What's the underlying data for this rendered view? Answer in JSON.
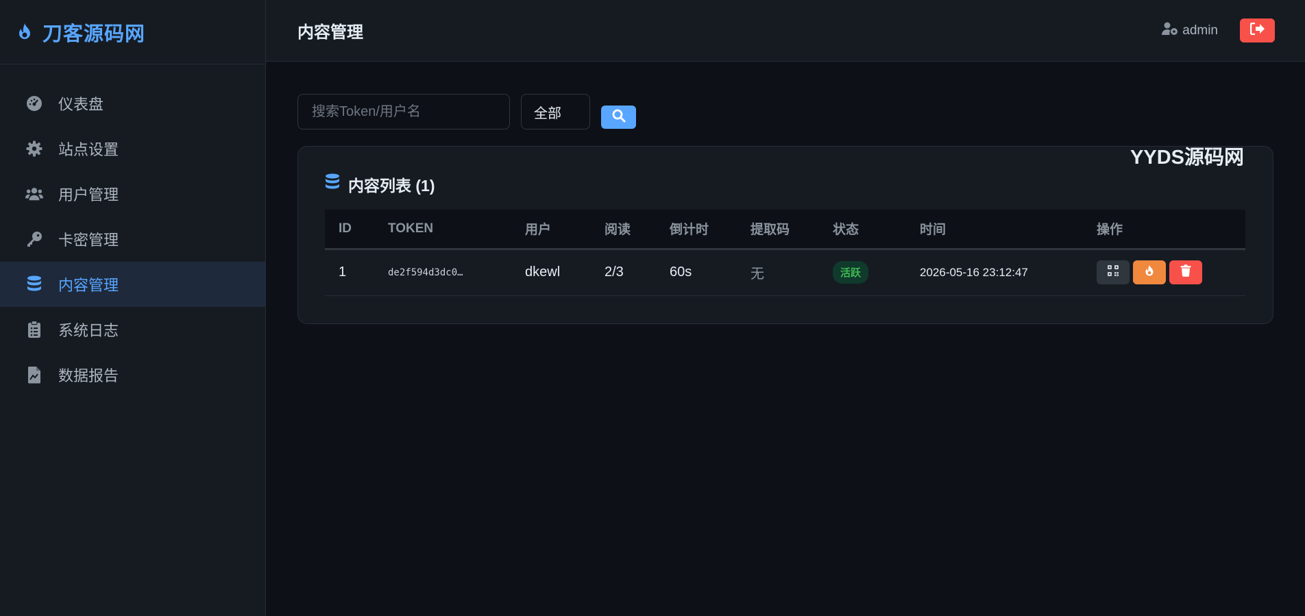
{
  "brand": {
    "name": "刀客源码网"
  },
  "sidebar": {
    "items": [
      {
        "label": "仪表盘",
        "icon": "dashboard-icon"
      },
      {
        "label": "站点设置",
        "icon": "gear-icon"
      },
      {
        "label": "用户管理",
        "icon": "users-icon"
      },
      {
        "label": "卡密管理",
        "icon": "key-icon"
      },
      {
        "label": "内容管理",
        "icon": "database-icon",
        "active": true
      },
      {
        "label": "系统日志",
        "icon": "clipboard-icon"
      },
      {
        "label": "数据报告",
        "icon": "report-icon"
      }
    ]
  },
  "header": {
    "title": "内容管理",
    "user": "admin"
  },
  "filters": {
    "search_placeholder": "搜索Token/用户名",
    "select_value": "全部"
  },
  "watermark": "YYDS源码网",
  "card": {
    "title": "内容列表 (1)"
  },
  "table": {
    "headers": [
      "ID",
      "TOKEN",
      "用户",
      "阅读",
      "倒计时",
      "提取码",
      "状态",
      "时间",
      "操作"
    ],
    "rows": [
      {
        "id": "1",
        "token": "de2f594d3dc0…",
        "user": "dkewl",
        "reads": "2/3",
        "countdown": "60s",
        "code": "无",
        "status": "活跃",
        "time": "2026-05-16 23:12:47"
      }
    ]
  },
  "colors": {
    "accent": "#58a6ff",
    "danger": "#f85149",
    "warning": "#f0883e",
    "success": "#3fb950"
  }
}
